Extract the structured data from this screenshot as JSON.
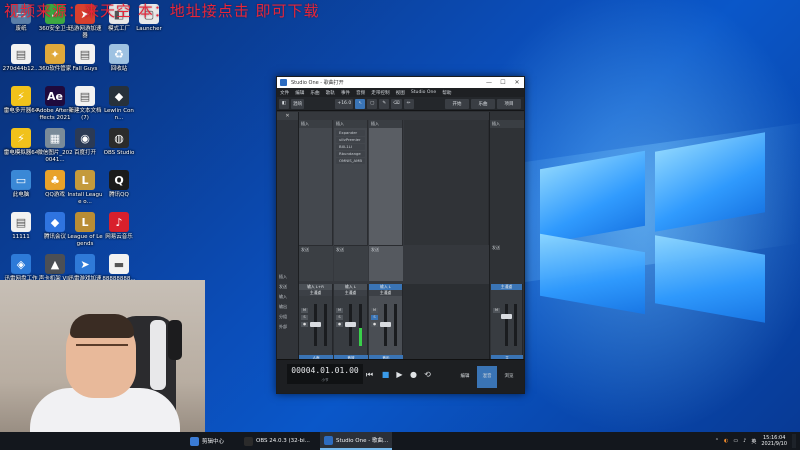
{
  "overlay": {
    "watermark": "视频来源：来天空 本：地址接点击 即可下载"
  },
  "desktop": {
    "icons": [
      {
        "label": "废纸",
        "icon": "recycle-bin-icon",
        "color": "#5b7fa8",
        "glyph": "▭"
      },
      {
        "label": "360安全卫士",
        "icon": "shield-icon",
        "color": "#3da842",
        "glyph": "✓"
      },
      {
        "label": "迅游网游加速器",
        "icon": "accelerator-icon",
        "color": "#d8402f",
        "glyph": "➤"
      },
      {
        "label": "模式工厂",
        "icon": "format-factory-icon",
        "color": "#e9e9e9",
        "glyph": "◧"
      },
      {
        "label": "Launcher",
        "icon": "launcher-icon",
        "color": "#e9e9e9",
        "glyph": "▢"
      },
      {
        "label": "270d44b12...",
        "icon": "file-icon",
        "color": "#f2f2f2",
        "glyph": "▤"
      },
      {
        "label": "360软件管家",
        "icon": "software-manager-icon",
        "color": "#e0a93b",
        "glyph": "✦"
      },
      {
        "label": "Fall Guys",
        "icon": "fall-guys-icon",
        "color": "#f2f2f2",
        "glyph": "▤"
      },
      {
        "label": "回收站",
        "icon": "trash-icon",
        "color": "#9ec2e2",
        "glyph": "♻"
      },
      {
        "label": "雷电多开器64",
        "icon": "ldplayer-icon",
        "color": "#f1c21b",
        "glyph": "⚡"
      },
      {
        "label": "Adobe After Effects 2021",
        "icon": "after-effects-icon",
        "color": "#1f0a3d",
        "glyph": "Ae"
      },
      {
        "label": "新建文本文档(7)",
        "icon": "text-doc-icon",
        "color": "#f2f2f2",
        "glyph": "▤"
      },
      {
        "label": "Lewlin Conn...",
        "icon": "connector-icon",
        "color": "#27313b",
        "glyph": "◆"
      },
      {
        "label": "雷电模拟器64",
        "icon": "ldplayer-icon",
        "color": "#f1c21b",
        "glyph": "⚡"
      },
      {
        "label": "微信图片_2020041...",
        "icon": "image-icon",
        "color": "#7a8b99",
        "glyph": "▦"
      },
      {
        "label": "百度打开",
        "icon": "baidu-icon",
        "color": "#2b3a55",
        "glyph": "◉"
      },
      {
        "label": "OBS Studio",
        "icon": "obs-icon",
        "color": "#2b2b2b",
        "glyph": "◍"
      },
      {
        "label": "此电脑",
        "icon": "computer-icon",
        "color": "#3a88d6",
        "glyph": "▭"
      },
      {
        "label": "QQ游戏",
        "icon": "qq-game-icon",
        "color": "#e8a22a",
        "glyph": "♣"
      },
      {
        "label": "Install League o...",
        "icon": "league-installer-icon",
        "color": "#c49a3c",
        "glyph": "L"
      },
      {
        "label": "腾讯QQ",
        "icon": "qq-icon",
        "color": "#1b1b1b",
        "glyph": "Q"
      },
      {
        "label": "11111",
        "icon": "file-icon",
        "color": "#f2f2f2",
        "glyph": "▤"
      },
      {
        "label": "腾讯会议",
        "icon": "tencent-meeting-icon",
        "color": "#2f74e0",
        "glyph": "◆"
      },
      {
        "label": "League of Legends",
        "icon": "league-icon",
        "color": "#b98d35",
        "glyph": "L"
      },
      {
        "label": "网易云音乐",
        "icon": "netease-music-icon",
        "color": "#d8202c",
        "glyph": "♪"
      },
      {
        "label": "迅雷网盘工作空间",
        "icon": "cloud-drive-icon",
        "color": "#2d7ad8",
        "glyph": "◈"
      },
      {
        "label": "声卡机架 VIP",
        "icon": "soundcard-icon",
        "color": "#4b4f55",
        "glyph": "▲"
      },
      {
        "label": "迅雷游戏加速器",
        "icon": "game-accelerator-icon",
        "color": "#2f7ad8",
        "glyph": "➤"
      },
      {
        "label": "88888888...",
        "icon": "file-icon",
        "color": "#f2f2f2",
        "glyph": "▬"
      }
    ]
  },
  "studio_one": {
    "title": "Studio One - 歌曲打开",
    "window_controls": [
      "—",
      "☐",
      "✕"
    ],
    "menu": [
      "文件",
      "编辑",
      "乐曲",
      "歌轨",
      "事件",
      "音频",
      "走带控制",
      "视图",
      "Studio One",
      "帮助"
    ],
    "toolbar": {
      "button_a": "◧",
      "label_a": "混响",
      "button_b": "+16.0",
      "tools": [
        "↖",
        "▢",
        "✎",
        "⌫",
        "✏"
      ],
      "tabs": [
        "开始",
        "乐曲",
        "项目"
      ]
    },
    "inspector_labels": [
      "插入",
      "发送",
      "输入",
      "输出",
      "分组",
      "外部"
    ],
    "columns": [
      {
        "title": "插入",
        "plugins": []
      },
      {
        "title": "插入",
        "plugins": [
          "Expander",
          "uIlvPremier",
          "BXL1LI",
          "Rbundange",
          "OMNIS_AMB"
        ]
      },
      {
        "title": "插入",
        "plugins": []
      }
    ],
    "sends": [
      "发送",
      "发送",
      "发送"
    ],
    "channel_names": [
      "输入 L+R",
      "输入 L",
      "输入 L"
    ],
    "channel_sub": [
      "主通道",
      "主通道",
      "主通道"
    ],
    "strip_footers": [
      "人声",
      "音效",
      "音乐"
    ],
    "right_panel": {
      "title": "插入",
      "send": "发送",
      "strip": "主通道",
      "footer": "主"
    },
    "transport": {
      "time": "00004.01.01.00",
      "unit": "小节",
      "buttons": [
        "编辑",
        "混音",
        "浏览"
      ]
    }
  },
  "taskbar": {
    "items": [
      {
        "label": "剪辑中心",
        "color": "#3a7bd5"
      },
      {
        "label": "OBS 24.0.3 (32-bi...",
        "color": "#2b2b2b"
      },
      {
        "label": "Studio One - 歌曲...",
        "color": "#2d6cc0"
      }
    ],
    "tray_icons": [
      "⌃",
      "◐",
      "▭",
      "♪",
      "英"
    ],
    "time": "15:16:04",
    "date": "2021/9/10"
  }
}
